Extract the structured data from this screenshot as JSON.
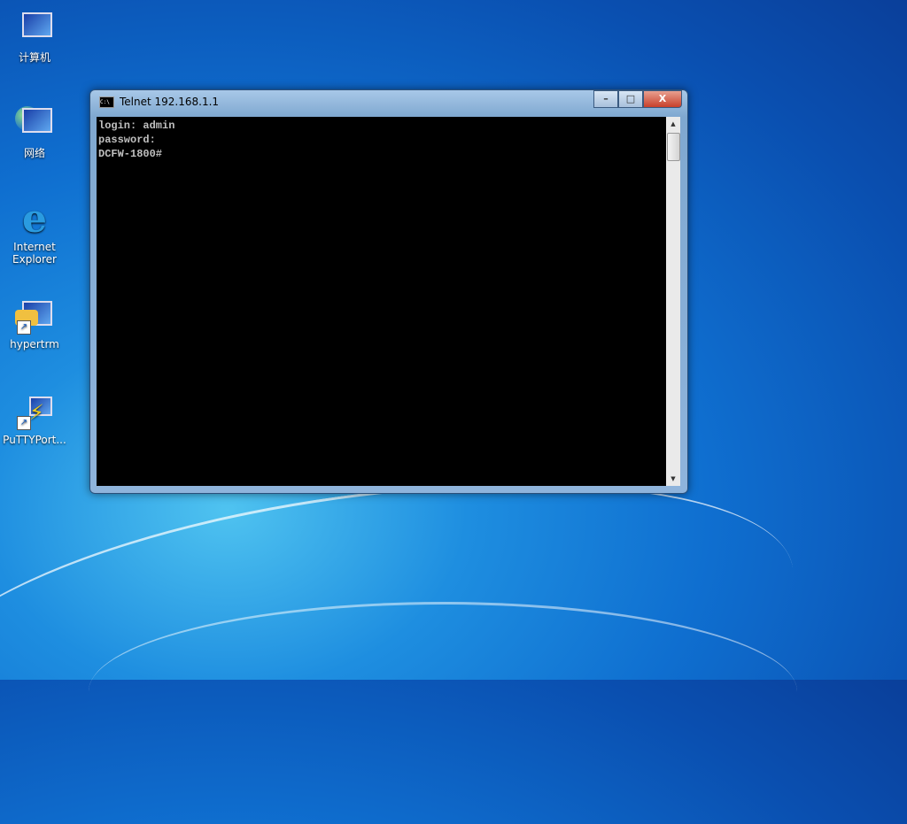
{
  "desktop": {
    "icons": [
      {
        "label": "计算机",
        "icon": "computer-icon"
      },
      {
        "label": "网络",
        "icon": "network-icon"
      },
      {
        "label": "Internet Explorer",
        "icon": "ie-icon"
      },
      {
        "label": "hypertrm",
        "icon": "hyperterminal-icon"
      },
      {
        "label": "PuTTYPort...",
        "icon": "putty-icon"
      }
    ]
  },
  "window": {
    "title": "Telnet 192.168.1.1",
    "lines": [
      "login: admin",
      "password:",
      "DCFW-1800#"
    ]
  }
}
